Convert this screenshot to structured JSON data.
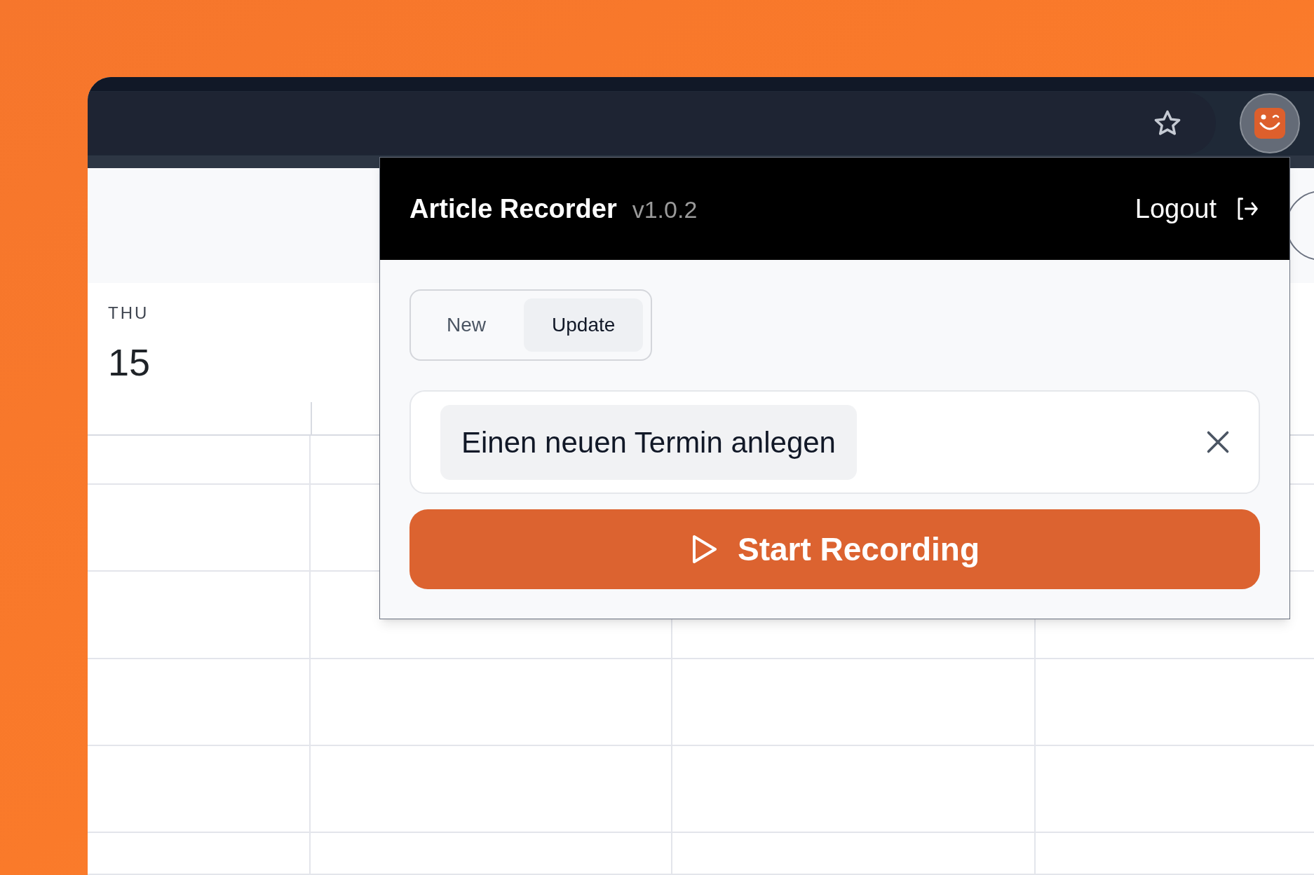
{
  "calendar": {
    "day_name": "THU",
    "day_number": "15"
  },
  "popup": {
    "title": "Article Recorder",
    "version": "v1.0.2",
    "logout": "Logout",
    "tabs": [
      {
        "label": "New",
        "selected": false
      },
      {
        "label": "Update",
        "selected": true
      }
    ],
    "tag": "Einen neuen Termin anlegen",
    "button": "Start Recording"
  }
}
